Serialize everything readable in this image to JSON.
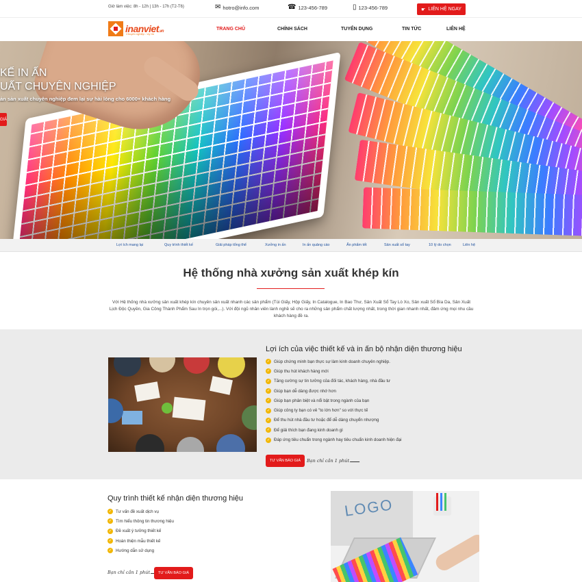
{
  "topbar": {
    "hours": "Giờ làm việc: 8h - 12h | 13h - 17h (T2-T6)",
    "email": "hotro@info.com",
    "phone": "123-456-789",
    "mobile": "123-456-789",
    "cta": "LIÊN HỆ NGAY"
  },
  "header": {
    "logo_text": "inanviet",
    "logo_suffix": ".vn",
    "logo_tagline": "Chuyên nghiệp - Uy tín",
    "nav": [
      "TRANG CHỦ",
      "CHÍNH SÁCH",
      "TUYỂN DỤNG",
      "TIN TỨC",
      "LIÊN HỆ"
    ],
    "active_index": 0
  },
  "hero": {
    "title_1": "KẾ IN ẤN",
    "title_2": "UẤT CHUYÊN NGHIỆP",
    "subtitle": "ản sản xuất chuyên nghiệp đem lại sự hài lòng cho 6000+ khách hàng",
    "button": "Giá"
  },
  "subnav": [
    "Lợi ích mang lại",
    "Quy trình thiết kế",
    "Giải pháp tổng thể",
    "Xưởng in ấn",
    "In ấn quảng cáo",
    "Ấn phẩm tết",
    "Sản xuất sổ tay",
    "10 lý do chọn",
    "Liên hệ"
  ],
  "intro": {
    "title": "Hệ thống nhà xưởng sản xuất khép kín",
    "text": "Với Hệ thống nhà xưởng sản xuất khép kín chuyên sản xuất nhanh các sản phẩm (Túi Giấy, Hộp Giấy, In Catalogue, In Bao Thư, Sản Xuất Sổ Tay Lò Xo, Sản xuất Sổ Bìa Da, Sản Xuất Lịch Độc Quyền, Gia Công Thành Phẩm Sau In trọn gói,...). Với đội ngũ nhân viên lành nghề sẽ cho ra những sản phẩm chất lượng nhất, trong thời gian nhanh nhất, đảm ứng mọi nhu cầu khách hàng đề ra."
  },
  "benefits": {
    "title": "Lợi ích của việc thiết kế và in ấn bộ nhận diện thương hiệu",
    "items": [
      "Giúp chứng minh bạn thực sự làm kinh doanh chuyên nghiệp.",
      "Giúp thu hút khách hàng mới",
      "Tăng cường sự tin tưởng của đối tác, khách hàng, nhà đầu tư",
      "Giúp bạn dễ dàng được nhớ hơn",
      "Giúp bạn phân biệt và nổi bật trong ngành của bạn",
      "Giúp công ty bạn có vẻ \"to lớn hơn\" so với thực tế",
      "Để thu hút nhà đầu tư hoặc để dễ dàng chuyển nhượng",
      "Để giải thích bạn đang kinh doanh gì",
      "Đáp ứng tiêu chuẩn trong ngành hay tiêu chuẩn kinh doanh hiện đại"
    ],
    "button": "TƯ VẤN BÁO GIÁ",
    "note": "Bạn chỉ cần 1 phút"
  },
  "process": {
    "title": "Quy trình thiết kế nhận diện thương hiệu",
    "items": [
      "Tư vấn đề xuất dịch vụ",
      "Tìm hiểu thông tin thương hiệu",
      "Đề xuất ý tưởng thiết kế",
      "Hoàn thiện mẫu thiết kế",
      "Hướng dẫn sử dụng"
    ],
    "button": "TƯ VẤN BÁO GIÁ",
    "note": "Bạn chỉ cần 1 phút",
    "photo_text": "LOGO"
  },
  "colors": {
    "accent": "#e21b1b",
    "check": "#f2b705",
    "subnav_link": "#1d4f9c",
    "logo": "#e8491b"
  }
}
